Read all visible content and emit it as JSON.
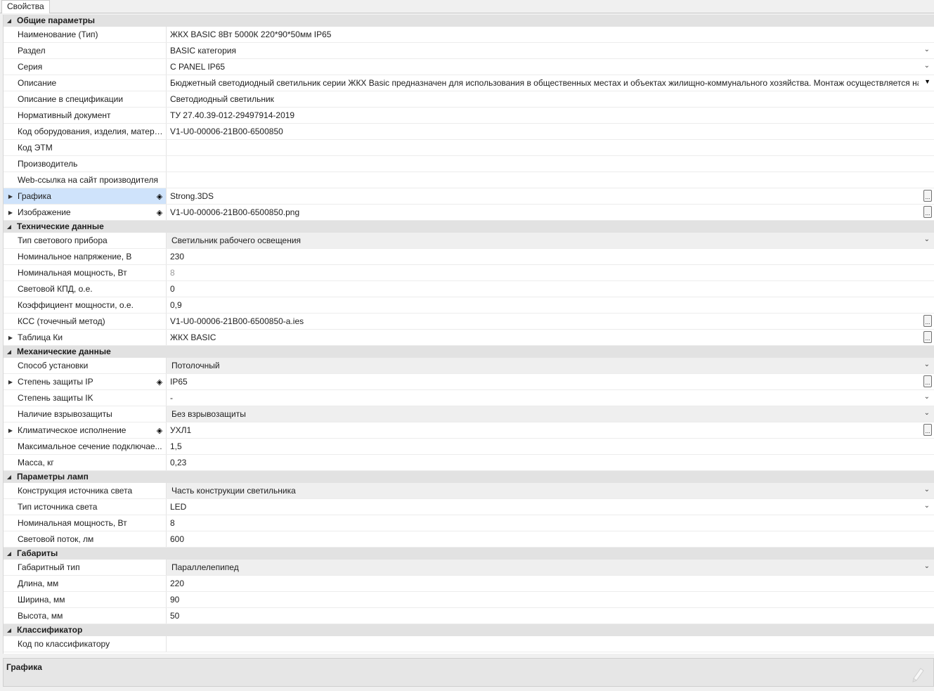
{
  "tab": {
    "label": "Свойства"
  },
  "categories": [
    {
      "label": "Общие параметры",
      "rows": [
        {
          "name": "Наименование (Тип)",
          "value": "ЖКХ BASIC 8Вт 5000К 220*90*50мм IP65"
        },
        {
          "name": "Раздел",
          "value": "BASIC категория",
          "control": "dropdown"
        },
        {
          "name": "Серия",
          "value": "C PANEL IP65",
          "control": "dropdown"
        },
        {
          "name": "Описание",
          "value": "Бюджетный светодиодный светильник серии ЖКХ Basic предназначен для использования в общественных местах и объектах жилищно-коммунального хозяйства. Монтаж осуществляется на потолок",
          "control": "dropdown-solid"
        },
        {
          "name": "Описание в спецификации",
          "value": "Светодиодный светильник"
        },
        {
          "name": "Нормативный документ",
          "value": "ТУ 27.40.39-012-29497914-2019"
        },
        {
          "name": "Код оборудования, изделия, матери...",
          "value": "V1-U0-00006-21B00-6500850"
        },
        {
          "name": "Код ЭТМ",
          "value": ""
        },
        {
          "name": "Производитель",
          "value": ""
        },
        {
          "name": "Web-ссылка на сайт производителя",
          "value": ""
        },
        {
          "name": "Графика",
          "value": "Strong.3DS",
          "expandable": true,
          "diamond": true,
          "selected": true,
          "control": "ellipsis"
        },
        {
          "name": "Изображение",
          "value": "V1-U0-00006-21B00-6500850.png",
          "expandable": true,
          "diamond": true,
          "control": "ellipsis"
        }
      ]
    },
    {
      "label": "Технические данные",
      "rows": [
        {
          "name": "Тип светового прибора",
          "value": "Светильник рабочего освещения",
          "control": "combo"
        },
        {
          "name": "Номинальное напряжение, В",
          "value": "230"
        },
        {
          "name": "Номинальная мощность, Вт",
          "value": "8",
          "disabled": true
        },
        {
          "name": "Световой КПД, о.е.",
          "value": "0"
        },
        {
          "name": "Коэффициент мощности, о.е.",
          "value": "0,9"
        },
        {
          "name": "КСС (точечный метод)",
          "value": "V1-U0-00006-21B00-6500850-a.ies",
          "control": "ellipsis"
        },
        {
          "name": "Таблица Ки",
          "value": "ЖКХ BASIC",
          "expandable": true,
          "control": "ellipsis"
        }
      ]
    },
    {
      "label": "Механические данные",
      "rows": [
        {
          "name": "Способ установки",
          "value": "Потолочный",
          "control": "combo"
        },
        {
          "name": "Степень защиты IP",
          "value": "IP65",
          "expandable": true,
          "diamond": true,
          "control": "ellipsis"
        },
        {
          "name": "Степень защиты IK",
          "value": "-",
          "control": "dropdown"
        },
        {
          "name": "Наличие взрывозащиты",
          "value": "Без взрывозащиты",
          "control": "combo"
        },
        {
          "name": "Климатическое исполнение",
          "value": "УХЛ1",
          "expandable": true,
          "diamond": true,
          "control": "ellipsis"
        },
        {
          "name": "Максимальное сечение подключае...",
          "value": "1,5"
        },
        {
          "name": "Масса, кг",
          "value": "0,23"
        }
      ]
    },
    {
      "label": "Параметры ламп",
      "rows": [
        {
          "name": "Конструкция источника света",
          "value": "Часть конструкции светильника",
          "control": "combo"
        },
        {
          "name": "Тип источника света",
          "value": "LED",
          "control": "dropdown"
        },
        {
          "name": "Номинальная мощность, Вт",
          "value": "8"
        },
        {
          "name": "Световой поток, лм",
          "value": "600"
        }
      ]
    },
    {
      "label": "Габариты",
      "rows": [
        {
          "name": "Габаритный тип",
          "value": "Параллелепипед",
          "control": "combo"
        },
        {
          "name": "Длина, мм",
          "value": "220"
        },
        {
          "name": "Ширина, мм",
          "value": "90"
        },
        {
          "name": "Высота, мм",
          "value": "50"
        }
      ]
    },
    {
      "label": "Классификатор",
      "rows": [
        {
          "name": "Код по классификатору",
          "value": ""
        }
      ]
    }
  ],
  "description_panel": {
    "title": "Графика"
  },
  "icons": {
    "collapse": "collapse-triangle-icon",
    "expand": "expand-triangle-icon",
    "diamond": "diamond-icon",
    "dropdown": "chevron-down-icon",
    "ellipsis": "ellipsis-button-icon"
  }
}
